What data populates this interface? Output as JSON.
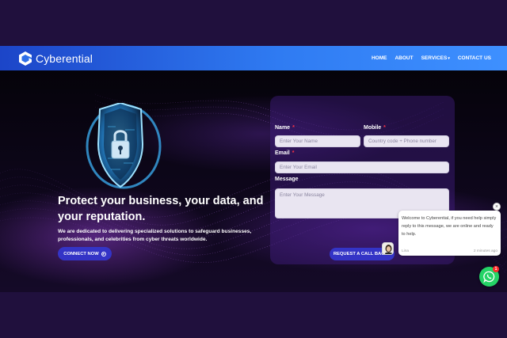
{
  "brand": {
    "name": "Cyberential"
  },
  "nav": {
    "items": [
      {
        "label": "HOME"
      },
      {
        "label": "ABOUT"
      },
      {
        "label": "SERVICES",
        "has_dropdown": true
      },
      {
        "label": "CONTACT US"
      }
    ]
  },
  "hero": {
    "title": "Protect your business, your data, and your reputation.",
    "subtitle": "We are dedicated to delivering specialized solutions to safeguard businesses, professionals, and celebrities from cyber threats worldwide.",
    "cta_label": "CONNECT NOW"
  },
  "form": {
    "name_label": "Name",
    "name_placeholder": "Enter Your Name",
    "mobile_label": "Mobile",
    "mobile_placeholder": "Country code + Phone number",
    "email_label": "Email",
    "email_placeholder": "Enter Your Email",
    "message_label": "Message",
    "message_placeholder": "Enter Your Message",
    "required_mark": "*",
    "submit_label": "REQUEST A CALL BACK !"
  },
  "chat": {
    "message": "Welcome to Cyberential, if you need help simply reply to this message, we are online and ready to help.",
    "agent": "Lina",
    "time": "2 minutes ago",
    "close_glyph": "×",
    "badge_count": "1"
  },
  "colors": {
    "nav_gradient_start": "#1c45c8",
    "nav_gradient_end": "#3e90ff",
    "button": "#3434c6",
    "page_background": "#20103d",
    "whatsapp": "#25d366"
  },
  "icons": [
    "shield-lock-icon",
    "arrow-circle-icon",
    "whatsapp-icon",
    "close-icon",
    "logo-mark-icon"
  ]
}
